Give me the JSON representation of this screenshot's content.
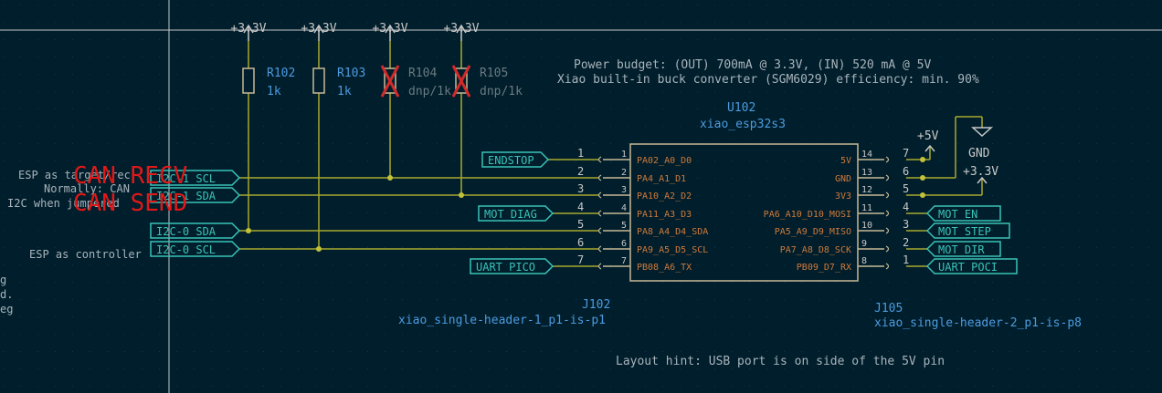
{
  "colors": {
    "background": "#001e2b",
    "grid": "#0b3a4a",
    "wire": "#a8a82f",
    "junction": "#c2c23a",
    "component": "#c8b996",
    "text": "#a9b4bc",
    "ref": "#4d9be0",
    "power": "#c9c9c9",
    "pin_name": "#d07a3c",
    "pin_num": "#c8c8c8",
    "label": "#3ac3b8",
    "dnp": "#d22a2a",
    "overlay_red": "#e01818",
    "cursor": "#c8c8c8"
  },
  "power_symbols": [
    "+3.3V",
    "+3.3V",
    "+3.3V",
    "+3.3V",
    "+5V",
    "GND",
    "+3.3V"
  ],
  "resistors": [
    {
      "ref": "R102",
      "value": "1k",
      "dnp": false
    },
    {
      "ref": "R103",
      "value": "1k",
      "dnp": false
    },
    {
      "ref": "R104",
      "value": "dnp/1k",
      "dnp": true
    },
    {
      "ref": "R105",
      "value": "dnp/1k",
      "dnp": true
    }
  ],
  "notes": {
    "power_budget": "Power budget: (OUT) 700mA @ 3.3V, (IN) 520 mA @ 5V",
    "buck": "Xiao built-in buck converter (SGM6029) efficiency: min. 90%",
    "layout_hint": "Layout hint: USB port is on side of the 5V pin",
    "esp_target": "ESP as target/rec",
    "normally_can": "Normally: CAN",
    "i2c_when": "I2C when jumpered",
    "esp_controller": "ESP as controller",
    "left_edge_1": "g",
    "left_edge_2": "d.",
    "left_edge_3": "eg"
  },
  "overlay": {
    "can_recv": "CAN RECV",
    "can_send": "CAN SEND"
  },
  "u102": {
    "ref": "U102",
    "value": "xiao_esp32s3",
    "left_pins": [
      {
        "num": "1",
        "name": "PA02_A0_D0"
      },
      {
        "num": "2",
        "name": "PA4_A1_D1"
      },
      {
        "num": "3",
        "name": "PA10_A2_D2"
      },
      {
        "num": "4",
        "name": "PA11_A3_D3"
      },
      {
        "num": "5",
        "name": "PA8_A4_D4_SDA"
      },
      {
        "num": "6",
        "name": "PA9_A5_D5_SCL"
      },
      {
        "num": "7",
        "name": "PB08_A6_TX"
      }
    ],
    "right_pins": [
      {
        "num": "14",
        "name": "5V"
      },
      {
        "num": "13",
        "name": "GND"
      },
      {
        "num": "12",
        "name": "3V3"
      },
      {
        "num": "11",
        "name": "PA6_A10_D10_MOSI"
      },
      {
        "num": "10",
        "name": "PA5_A9_D9_MISO"
      },
      {
        "num": "9",
        "name": "PA7_A8_D8_SCK"
      },
      {
        "num": "8",
        "name": "PB09_D7_RX"
      }
    ]
  },
  "j102": {
    "ref": "J102",
    "value": "xiao_single-header-1_p1-is-p1",
    "pins": [
      "1",
      "2",
      "3",
      "4",
      "5",
      "6",
      "7"
    ]
  },
  "j105": {
    "ref": "J105",
    "value": "xiao_single-header-2_p1-is-p8",
    "pins": [
      "7",
      "6",
      "5",
      "4",
      "3",
      "2",
      "1"
    ]
  },
  "left_labels": [
    "ENDSTOP",
    "I2C-1_SCL",
    "I2C-1_SDA",
    "MOT_DIAG",
    "I2C-0_SDA",
    "I2C-0_SCL",
    "UART_PICO"
  ],
  "right_labels": [
    "MOT_EN",
    "MOT_STEP",
    "MOT_DIR",
    "UART_POCI"
  ]
}
